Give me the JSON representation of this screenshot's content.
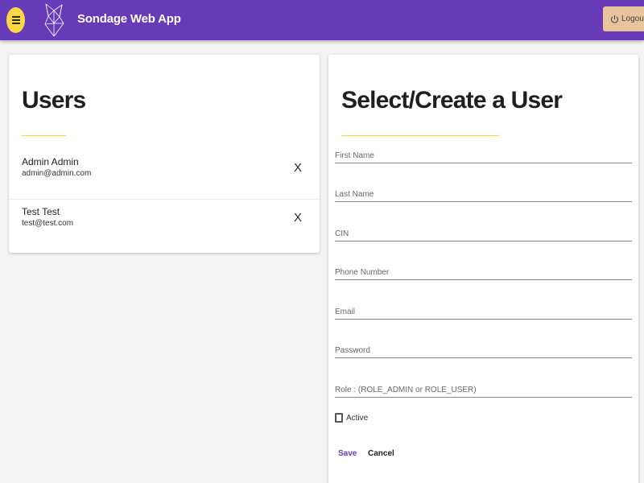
{
  "header": {
    "app_title": "Sondage Web App",
    "logout_label": "Logout",
    "colors": {
      "primary": "#673ab7",
      "accent": "#ffd740",
      "logout_bg": "#e8c39c"
    },
    "icons": {
      "menu": "hamburger-menu-icon",
      "logo": "geometric-fox-logo",
      "logout": "power-icon"
    }
  },
  "users_panel": {
    "title": "Users",
    "users": [
      {
        "name": "Admin Admin",
        "email": "admin@admin.com",
        "delete_label": "X"
      },
      {
        "name": "Test Test",
        "email": "test@test.com",
        "delete_label": "X"
      }
    ]
  },
  "form_panel": {
    "title": "Select/Create a User",
    "fields": [
      {
        "placeholder": "First Name",
        "value": ""
      },
      {
        "placeholder": "Last Name",
        "value": ""
      },
      {
        "placeholder": "CIN",
        "value": ""
      },
      {
        "placeholder": "Phone Number",
        "value": ""
      },
      {
        "placeholder": "Email",
        "value": ""
      },
      {
        "placeholder": "Password",
        "value": ""
      },
      {
        "placeholder": "Role : (ROLE_ADMIN or ROLE_USER)",
        "value": ""
      }
    ],
    "active_label": "Active",
    "active_checked": false,
    "save_label": "Save",
    "cancel_label": "Cancel"
  }
}
